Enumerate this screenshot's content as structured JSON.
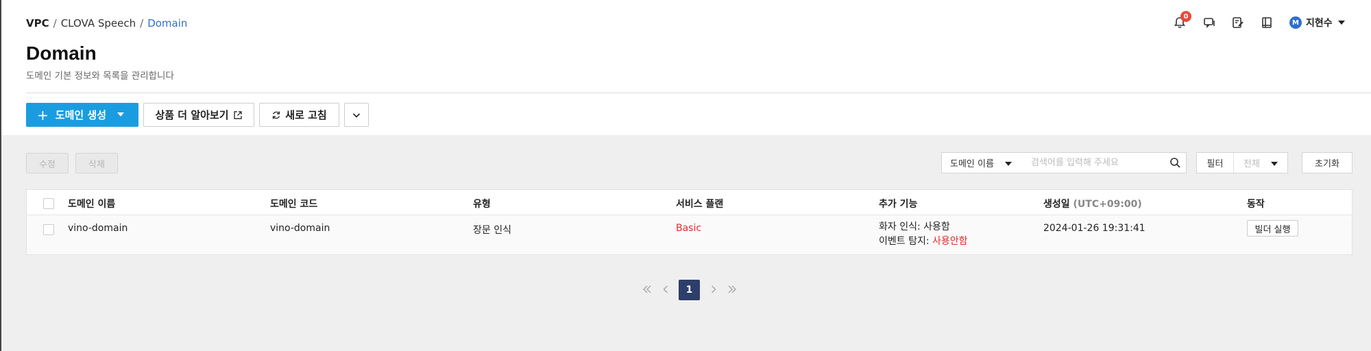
{
  "breadcrumb": {
    "items": [
      "VPC",
      "CLOVA Speech",
      "Domain"
    ],
    "separator": "/"
  },
  "header": {
    "title": "Domain",
    "subtitle": "도메인 기본 정보와 목록을 관리합니다",
    "notification_count": "0",
    "user": {
      "initial": "M",
      "name": "지현수"
    }
  },
  "toolbar": {
    "create_label": "도메인 생성",
    "learn_more_label": "상품 더 알아보기",
    "refresh_label": "새로 고침"
  },
  "actions": {
    "edit_label": "수정",
    "delete_label": "삭제"
  },
  "search": {
    "field_selected": "도메인 이름",
    "placeholder": "검색어를 입력해 주세요",
    "filter_label": "필터",
    "filter_value": "전체",
    "reset_label": "초기화"
  },
  "table": {
    "columns": [
      "도메인 이름",
      "도메인 코드",
      "유형",
      "서비스 플랜",
      "추가 기능",
      "생성일",
      "동작"
    ],
    "created_unit": "(UTC+09:00)",
    "rows": [
      {
        "name": "vino-domain",
        "code": "vino-domain",
        "type": "장문 인식",
        "plan": "Basic",
        "feature1_label": "화자 인식: ",
        "feature1_value": "사용함",
        "feature2_label": "이벤트 탐지: ",
        "feature2_value": "사용안함",
        "created": "2024-01-26 19:31:41",
        "action_label": "빌더 실행"
      }
    ]
  },
  "pagination": {
    "current": "1"
  },
  "colors": {
    "primary": "#1a9de0",
    "link": "#2f6fd0",
    "danger": "#e02b2b",
    "page_active": "#2d3e6a",
    "badge": "#e84a3c"
  }
}
